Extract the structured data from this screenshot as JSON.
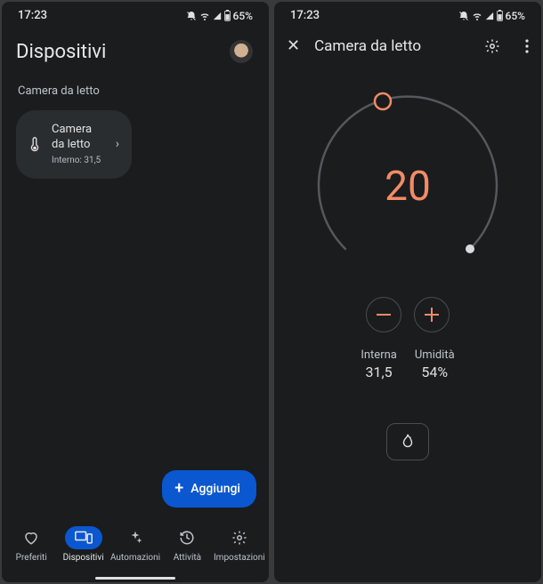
{
  "status": {
    "time": "17:23",
    "battery": "65%"
  },
  "left": {
    "title": "Dispositivi",
    "section": "Camera da letto",
    "device": {
      "name": "Camera da letto",
      "sub": "Interno: 31,5"
    },
    "add": "Aggiungi",
    "nav": {
      "favorites": "Preferiti",
      "devices": "Dispositivi",
      "automations": "Automazioni",
      "activity": "Attività",
      "settings": "Impostazioni"
    }
  },
  "right": {
    "title": "Camera da letto",
    "setpoint": "20",
    "interna_label": "Interna",
    "interna_value": "31,5",
    "umidita_label": "Umidità",
    "umidita_value": "54%"
  }
}
